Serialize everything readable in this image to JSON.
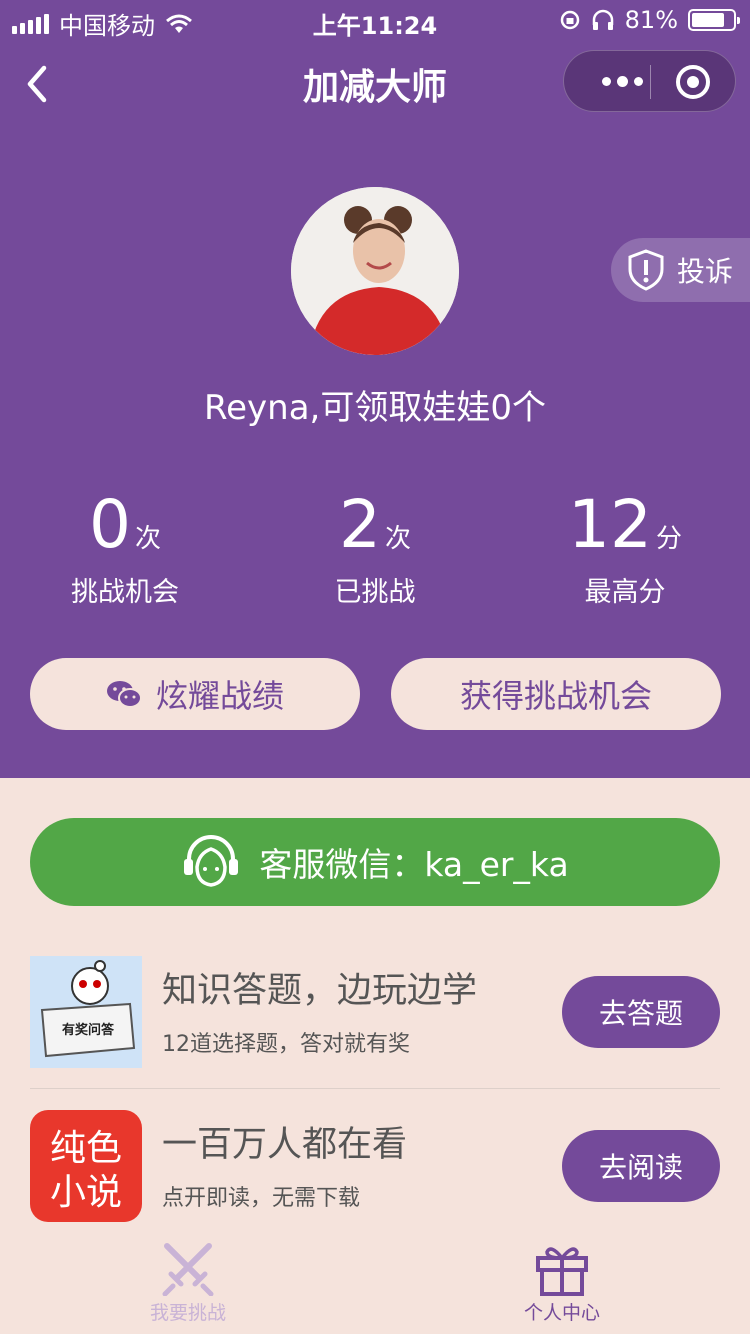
{
  "status_bar": {
    "carrier": "中国移动",
    "time": "上午11:24",
    "battery": "81%",
    "battery_level": 0.81
  },
  "nav": {
    "title": "加减大师"
  },
  "complain": {
    "label": "投诉"
  },
  "user": {
    "greeting": "Reyna,可领取娃娃0个"
  },
  "stats": [
    {
      "value": "0",
      "unit": "次",
      "label": "挑战机会"
    },
    {
      "value": "2",
      "unit": "次",
      "label": "已挑战"
    },
    {
      "value": "12",
      "unit": "分",
      "label": "最高分"
    }
  ],
  "actions": {
    "show_off": "炫耀战绩",
    "get_chance": "获得挑战机会"
  },
  "service": {
    "label": "客服微信：ka_er_ka"
  },
  "promos": [
    {
      "title": "知识答题，边玩边学",
      "subtitle": "12道选择题，答对就有奖",
      "button": "去答题",
      "badge": "有奖问答"
    },
    {
      "title": "一百万人都在看",
      "subtitle": "点开即读，无需下载",
      "button": "去阅读",
      "logo_line1": "纯色",
      "logo_line2": "小说"
    }
  ],
  "tabs": [
    {
      "label": "我要挑战",
      "color": "#c9b3d6"
    },
    {
      "label": "个人中心",
      "color": "#744a9a"
    }
  ],
  "colors": {
    "primary": "#744a9a",
    "background": "#f5e3dc",
    "service_green": "#52a747"
  }
}
